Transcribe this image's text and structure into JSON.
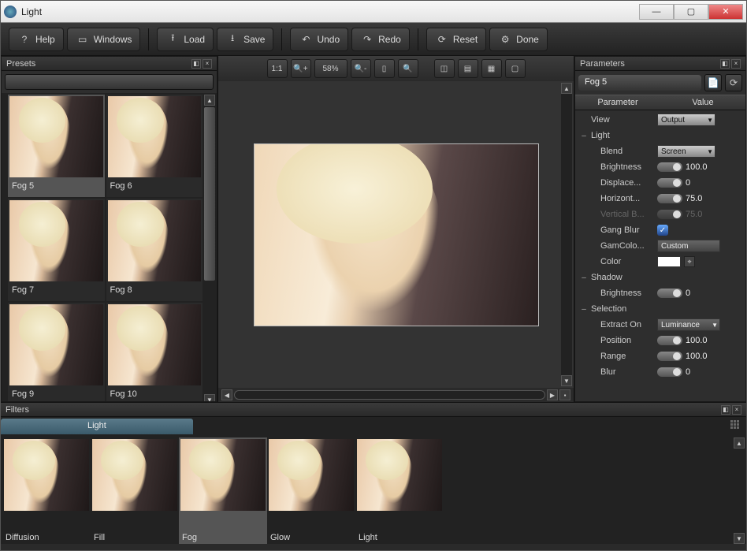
{
  "window": {
    "title": "Light"
  },
  "toolbar": {
    "help": "Help",
    "windows": "Windows",
    "load": "Load",
    "save": "Save",
    "undo": "Undo",
    "redo": "Redo",
    "reset": "Reset",
    "done": "Done"
  },
  "presets_panel": {
    "title": "Presets",
    "items": [
      {
        "label": "Fog 5",
        "selected": true
      },
      {
        "label": "Fog 6"
      },
      {
        "label": "Fog 7"
      },
      {
        "label": "Fog 8"
      },
      {
        "label": "Fog 9"
      },
      {
        "label": "Fog 10"
      }
    ]
  },
  "viewer": {
    "zoom_text": "58%"
  },
  "parameters": {
    "title": "Parameters",
    "current": "Fog 5",
    "col_param": "Parameter",
    "col_value": "Value",
    "rows": {
      "view_label": "View",
      "view_value": "Output",
      "light_label": "Light",
      "blend_label": "Blend",
      "blend_value": "Screen",
      "brightness_label": "Brightness",
      "brightness_value": "100.0",
      "displace_label": "Displace...",
      "displace_value": "0",
      "horiz_label": "Horizont...",
      "horiz_value": "75.0",
      "vert_label": "Vertical B...",
      "vert_value": "75.0",
      "gang_label": "Gang Blur",
      "gamcolor_label": "GamColo...",
      "gamcolor_value": "Custom",
      "color_label": "Color",
      "shadow_label": "Shadow",
      "s_brightness_label": "Brightness",
      "s_brightness_value": "0",
      "selection_label": "Selection",
      "extract_label": "Extract On",
      "extract_value": "Luminance",
      "position_label": "Position",
      "position_value": "100.0",
      "range_label": "Range",
      "range_value": "100.0",
      "blur_label": "Blur",
      "blur_value": "0"
    }
  },
  "filters": {
    "title": "Filters",
    "tab": "Light",
    "items": [
      {
        "label": "Diffusion"
      },
      {
        "label": "Fill"
      },
      {
        "label": "Fog",
        "selected": true
      },
      {
        "label": "Glow"
      },
      {
        "label": "Light"
      }
    ]
  }
}
